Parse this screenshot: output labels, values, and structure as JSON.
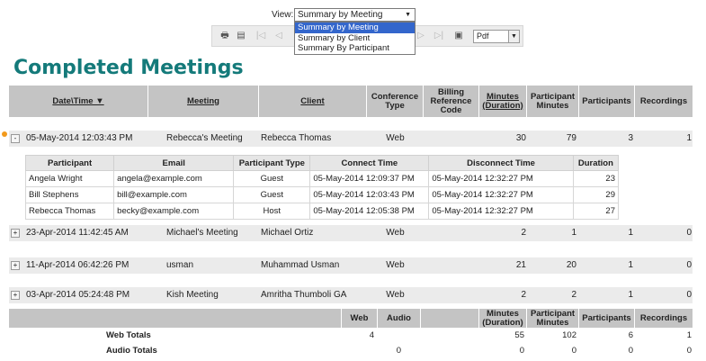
{
  "view": {
    "label": "View:",
    "selected": "Summary by Meeting",
    "options": [
      "Summary by Meeting",
      "Summary by Client",
      "Summary By Participant"
    ]
  },
  "toolbar": {
    "format": "Pdf",
    "icons": [
      "print-icon",
      "export-icon",
      "first-page-icon",
      "prev-page-icon",
      "next-page-icon",
      "last-page-icon",
      "save-icon"
    ]
  },
  "title": "Completed Meetings",
  "columns": {
    "datetime": "Date\\Time ▼",
    "meeting": "Meeting",
    "client": "Client",
    "conference_type": "Conference Type",
    "billing_ref": "Billing Reference Code",
    "minutes": "Minutes (Duration)",
    "participant_minutes": "Participant Minutes",
    "participants": "Participants",
    "recordings": "Recordings"
  },
  "meetings": [
    {
      "toggle": "-",
      "datetime": "05-May-2014 12:03:43 PM",
      "meeting": "Rebecca's Meeting",
      "client": "Rebecca Thomas",
      "type": "Web",
      "billing": "",
      "minutes": "30",
      "participant_minutes": "79",
      "participants": "3",
      "recordings": "1"
    },
    {
      "toggle": "+",
      "datetime": "23-Apr-2014 11:42:45 AM",
      "meeting": "Michael's Meeting",
      "client": "Michael Ortiz",
      "type": "Web",
      "billing": "",
      "minutes": "2",
      "participant_minutes": "1",
      "participants": "1",
      "recordings": "0"
    },
    {
      "toggle": "+",
      "datetime": "11-Apr-2014 06:42:26 PM",
      "meeting": "usman",
      "client": "Muhammad Usman",
      "type": "Web",
      "billing": "",
      "minutes": "21",
      "participant_minutes": "20",
      "participants": "1",
      "recordings": "0"
    },
    {
      "toggle": "+",
      "datetime": "03-Apr-2014 05:24:48 PM",
      "meeting": "Kish Meeting",
      "client": "Amritha Thumboli GA",
      "type": "Web",
      "billing": "",
      "minutes": "2",
      "participant_minutes": "2",
      "participants": "1",
      "recordings": "0"
    }
  ],
  "participants_table": {
    "headers": [
      "Participant",
      "Email",
      "Participant Type",
      "Connect Time",
      "Disconnect Time",
      "Duration"
    ],
    "rows": [
      [
        "Angela Wright",
        "angela@example.com",
        "Guest",
        "05-May-2014 12:09:37 PM",
        "05-May-2014 12:32:27 PM",
        "23"
      ],
      [
        "Bill Stephens",
        "bill@example.com",
        "Guest",
        "05-May-2014 12:03:43 PM",
        "05-May-2014 12:32:27 PM",
        "29"
      ],
      [
        "Rebecca Thomas",
        "becky@example.com",
        "Host",
        "05-May-2014 12:05:38 PM",
        "05-May-2014 12:32:27 PM",
        "27"
      ]
    ]
  },
  "totals": {
    "headers": {
      "web": "Web",
      "audio": "Audio",
      "minutes": "Minutes (Duration)",
      "participant_minutes": "Participant Minutes",
      "participants": "Participants",
      "recordings": "Recordings"
    },
    "web_row": {
      "label": "Web Totals",
      "web": "4",
      "audio": "",
      "minutes": "55",
      "participant_minutes": "102",
      "participants": "6",
      "recordings": "1"
    },
    "audio_row": {
      "label": "Audio Totals",
      "web": "",
      "audio": "0",
      "minutes": "0",
      "participant_minutes": "0",
      "participants": "0",
      "recordings": "0"
    }
  }
}
